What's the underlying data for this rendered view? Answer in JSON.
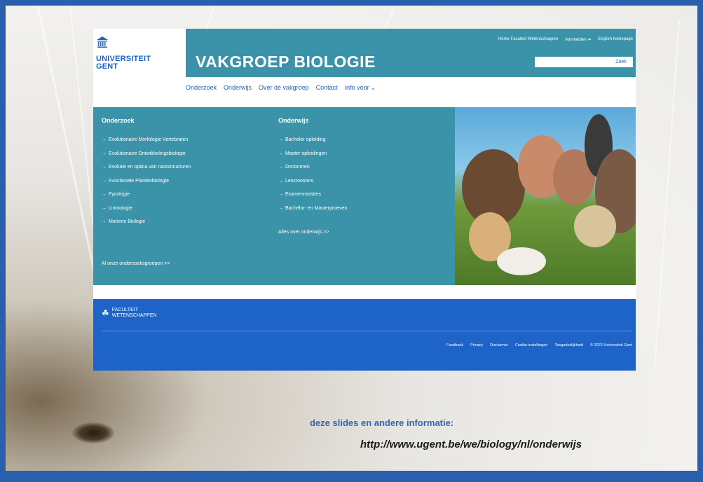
{
  "site": {
    "logo_text_line1": "UNIVERSITEIT",
    "logo_text_line2": "GENT",
    "title": "VAKGROEP BIOLOGIE",
    "toplinks": [
      "Home Faculteit Wetenschappen",
      "Aanmelden ➜",
      "English homepage"
    ],
    "search_placeholder": "",
    "search_button": "Zoek",
    "nav": [
      "Onderzoek",
      "Onderwijs",
      "Over de vakgroep",
      "Contact",
      "Info voor"
    ]
  },
  "onderzoek": {
    "title": "Onderzoek",
    "items": [
      "Evolutionaire Morfologie Vertebraten",
      "Evolutionaire Ontwikkelingsbiologie",
      "Evolutie en optica van nanostructuren",
      "Functionele Plantenbiologie",
      "Fycologie",
      "Limnologie",
      "Mariene Biologie"
    ],
    "link": "Al onze onderzoeksgroepen >>"
  },
  "onderwijs": {
    "title": "Onderwijs",
    "items": [
      "Bachelor opleiding",
      "Master opleidingen",
      "Doctoreren",
      "Lessroosters",
      "Examenroosters",
      "Bachelor- en Masterproeven"
    ],
    "link": "Alles over onderwijs >>"
  },
  "footer": {
    "logo_line1": "FACULTEIT",
    "logo_line2": "WETENSCHAPPEN",
    "links": [
      "Feedback",
      "Privacy",
      "Disclaimer",
      "Cookie-instellingen",
      "Toegankelijkheid",
      "© 2022 Universiteit Gent"
    ]
  },
  "slide": {
    "caption": "deze slides en andere informatie:",
    "url": "http://www.ugent.be/we/biology/nl/onderwijs"
  },
  "colors": {
    "banner": "#3a93a8",
    "ugent_blue": "#1e64c8",
    "slide_border": "#2a5fae"
  }
}
